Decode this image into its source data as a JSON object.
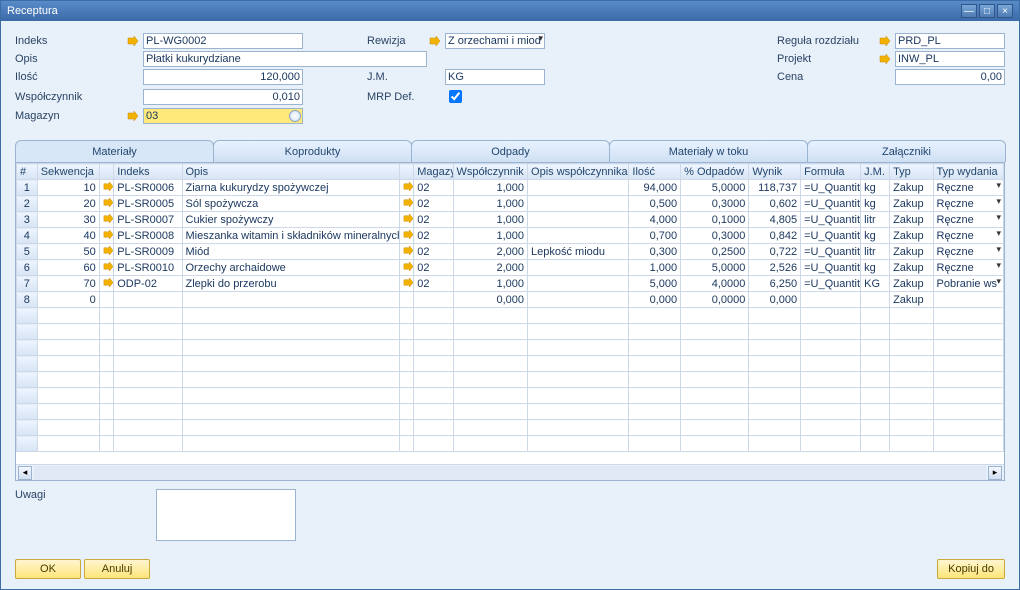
{
  "window": {
    "title": "Receptura"
  },
  "header": {
    "labels": {
      "indeks": "Indeks",
      "rewizja": "Rewizja",
      "regula": "Reguła rozdziału",
      "opis": "Opis",
      "projekt": "Projekt",
      "ilosc": "Ilość",
      "jm": "J.M.",
      "cena": "Cena",
      "wsp": "Współczynnik",
      "mrp": "MRP Def.",
      "magazyn": "Magazyn"
    },
    "values": {
      "indeks": "PL-WG0002",
      "rewizja": "Z orzechami i miod",
      "regula": "PRD_PL",
      "opis": "Płatki kukurydziane",
      "projekt": "INW_PL",
      "ilosc": "120,000",
      "jm": "KG",
      "cena": "0,00",
      "wsp": "0,010",
      "magazyn": "03"
    }
  },
  "tabs": [
    "Materiały",
    "Koprodukty",
    "Odpady",
    "Materiały w toku",
    "Załączniki"
  ],
  "columns": [
    "#",
    "Sekwencja",
    "Indeks",
    "Opis",
    "Magazyn",
    "Współczynnik",
    "Opis współczynnika",
    "Ilość",
    "% Odpadów",
    "Wynik",
    "Formuła",
    "J.M.",
    "Typ",
    "Typ wydania"
  ],
  "rows": [
    {
      "n": "1",
      "seq": "10",
      "idx": "PL-SR0006",
      "opis": "Ziarna kukurydzy spożywczej",
      "mag": "02",
      "wsp": "1,000",
      "owsp": "",
      "il": "94,000",
      "odp": "5,0000",
      "wyn": "118,737",
      "form": "=U_Quantity",
      "jm": "kg",
      "typ": "Zakup",
      "wyd": "Ręczne"
    },
    {
      "n": "2",
      "seq": "20",
      "idx": "PL-SR0005",
      "opis": "Sól spożywcza",
      "mag": "02",
      "wsp": "1,000",
      "owsp": "",
      "il": "0,500",
      "odp": "0,3000",
      "wyn": "0,602",
      "form": "=U_Quantity",
      "jm": "kg",
      "typ": "Zakup",
      "wyd": "Ręczne"
    },
    {
      "n": "3",
      "seq": "30",
      "idx": "PL-SR0007",
      "opis": "Cukier spożywczy",
      "mag": "02",
      "wsp": "1,000",
      "owsp": "",
      "il": "4,000",
      "odp": "0,1000",
      "wyn": "4,805",
      "form": "=U_Quantity",
      "jm": "litr",
      "typ": "Zakup",
      "wyd": "Ręczne"
    },
    {
      "n": "4",
      "seq": "40",
      "idx": "PL-SR0008",
      "opis": "Mieszanka witamin i składników mineralnych",
      "mag": "02",
      "wsp": "1,000",
      "owsp": "",
      "il": "0,700",
      "odp": "0,3000",
      "wyn": "0,842",
      "form": "=U_Quantity",
      "jm": "kg",
      "typ": "Zakup",
      "wyd": "Ręczne"
    },
    {
      "n": "5",
      "seq": "50",
      "idx": "PL-SR0009",
      "opis": "Miód",
      "mag": "02",
      "wsp": "2,000",
      "owsp": "Lepkość miodu",
      "il": "0,300",
      "odp": "0,2500",
      "wyn": "0,722",
      "form": "=U_Quantity",
      "jm": "litr",
      "typ": "Zakup",
      "wyd": "Ręczne"
    },
    {
      "n": "6",
      "seq": "60",
      "idx": "PL-SR0010",
      "opis": "Orzechy archaidowe",
      "mag": "02",
      "wsp": "2,000",
      "owsp": "",
      "il": "1,000",
      "odp": "5,0000",
      "wyn": "2,526",
      "form": "=U_Quantity",
      "jm": "kg",
      "typ": "Zakup",
      "wyd": "Ręczne"
    },
    {
      "n": "7",
      "seq": "70",
      "idx": "ODP-02",
      "opis": "Zlepki do przerobu",
      "mag": "02",
      "wsp": "1,000",
      "owsp": "",
      "il": "5,000",
      "odp": "4,0000",
      "wyn": "6,250",
      "form": "=U_Quantity",
      "jm": "KG",
      "typ": "Zakup",
      "wyd": "Pobranie ws"
    },
    {
      "n": "8",
      "seq": "0",
      "idx": "",
      "opis": "",
      "mag": "",
      "wsp": "0,000",
      "owsp": "",
      "il": "0,000",
      "odp": "0,0000",
      "wyn": "0,000",
      "form": "",
      "jm": "",
      "typ": "Zakup",
      "wyd": ""
    }
  ],
  "remarks": {
    "label": "Uwagi",
    "value": ""
  },
  "buttons": {
    "ok": "OK",
    "cancel": "Anuluj",
    "copy": "Kopiuj do"
  }
}
